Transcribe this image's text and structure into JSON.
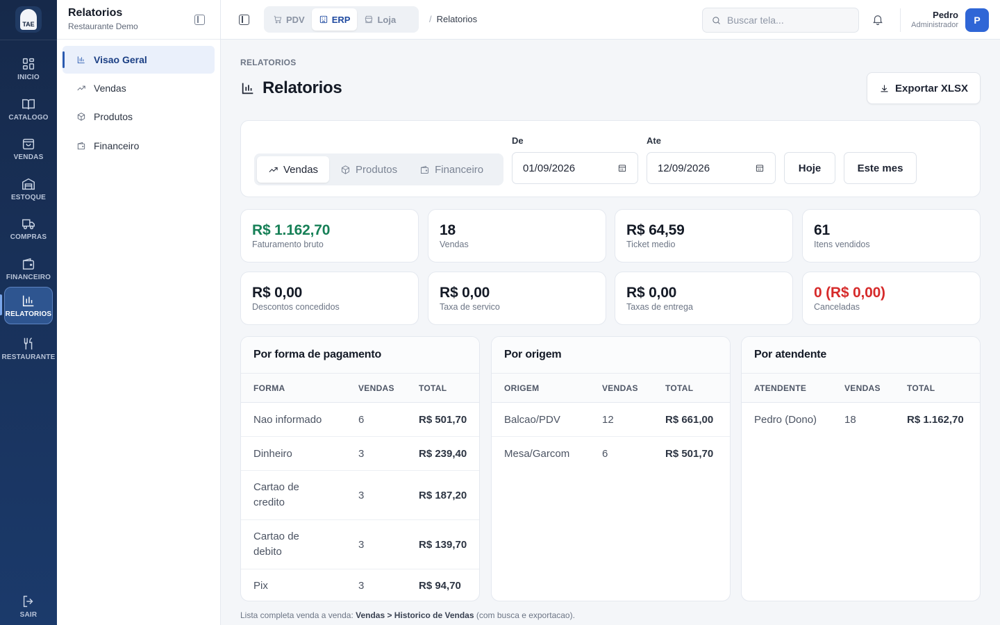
{
  "rail": {
    "logo_text": "TAE",
    "items": [
      {
        "label": "INICIO",
        "icon": "grid-icon"
      },
      {
        "label": "CATALOGO",
        "icon": "book-icon"
      },
      {
        "label": "VENDAS",
        "icon": "bag-icon"
      },
      {
        "label": "ESTOQUE",
        "icon": "warehouse-icon"
      },
      {
        "label": "COMPRAS",
        "icon": "truck-icon"
      },
      {
        "label": "FINANCEIRO",
        "icon": "wallet-icon"
      },
      {
        "label": "RELATORIOS",
        "icon": "bar-chart-icon",
        "active": true
      },
      {
        "label": "RESTAURANTE",
        "icon": "utensils-icon"
      }
    ],
    "logout_label": "SAIR"
  },
  "sidebar": {
    "title": "Relatorios",
    "subtitle": "Restaurante Demo",
    "items": [
      {
        "label": "Visao Geral",
        "icon": "bar-chart-icon",
        "active": true
      },
      {
        "label": "Vendas",
        "icon": "trend-up-icon"
      },
      {
        "label": "Produtos",
        "icon": "box-icon"
      },
      {
        "label": "Financeiro",
        "icon": "wallet-icon"
      }
    ]
  },
  "topbar": {
    "modes": [
      {
        "label": "PDV",
        "icon": "cart-icon"
      },
      {
        "label": "ERP",
        "icon": "building-icon",
        "active": true
      },
      {
        "label": "Loja",
        "icon": "store-icon"
      }
    ],
    "breadcrumb": "Relatorios",
    "search_placeholder": "Buscar tela...",
    "user_name": "Pedro",
    "user_role": "Administrador",
    "avatar_initial": "P"
  },
  "page": {
    "eyebrow": "RELATORIOS",
    "title": "Relatorios",
    "export_label": "Exportar XLSX"
  },
  "filters": {
    "tabs": [
      {
        "label": "Vendas",
        "icon": "trend-up-icon",
        "active": true
      },
      {
        "label": "Produtos",
        "icon": "box-icon"
      },
      {
        "label": "Financeiro",
        "icon": "wallet-icon"
      }
    ],
    "from_label": "De",
    "from_value": "01/09/2026",
    "to_label": "Ate",
    "to_value": "12/09/2026",
    "today_label": "Hoje",
    "month_label": "Este mes"
  },
  "stats": [
    {
      "value": "R$ 1.162,70",
      "label": "Faturamento bruto",
      "tone": "green"
    },
    {
      "value": "18",
      "label": "Vendas",
      "tone": ""
    },
    {
      "value": "R$ 64,59",
      "label": "Ticket medio",
      "tone": ""
    },
    {
      "value": "61",
      "label": "Itens vendidos",
      "tone": ""
    },
    {
      "value": "R$ 0,00",
      "label": "Descontos concedidos",
      "tone": ""
    },
    {
      "value": "R$ 0,00",
      "label": "Taxa de servico",
      "tone": ""
    },
    {
      "value": "R$ 0,00",
      "label": "Taxas de entrega",
      "tone": ""
    },
    {
      "value": "0 (R$ 0,00)",
      "label": "Canceladas",
      "tone": "red"
    }
  ],
  "tables": [
    {
      "title": "Por forma de pagamento",
      "columns": [
        "FORMA",
        "VENDAS",
        "TOTAL"
      ],
      "rows": [
        [
          "Nao informado",
          "6",
          "R$ 501,70"
        ],
        [
          "Dinheiro",
          "3",
          "R$ 239,40"
        ],
        [
          "Cartao de credito",
          "3",
          "R$ 187,20"
        ],
        [
          "Cartao de debito",
          "3",
          "R$ 139,70"
        ],
        [
          "Pix",
          "3",
          "R$ 94,70"
        ]
      ]
    },
    {
      "title": "Por origem",
      "columns": [
        "ORIGEM",
        "VENDAS",
        "TOTAL"
      ],
      "rows": [
        [
          "Balcao/PDV",
          "12",
          "R$ 661,00"
        ],
        [
          "Mesa/Garcom",
          "6",
          "R$ 501,70"
        ]
      ]
    },
    {
      "title": "Por atendente",
      "columns": [
        "ATENDENTE",
        "VENDAS",
        "TOTAL"
      ],
      "rows": [
        [
          "Pedro (Dono)",
          "18",
          "R$ 1.162,70"
        ]
      ]
    }
  ],
  "footnote": {
    "prefix": "Lista completa venda a venda: ",
    "link": "Vendas > Historico de Vendas",
    "suffix": " (com busca e exportacao)."
  }
}
